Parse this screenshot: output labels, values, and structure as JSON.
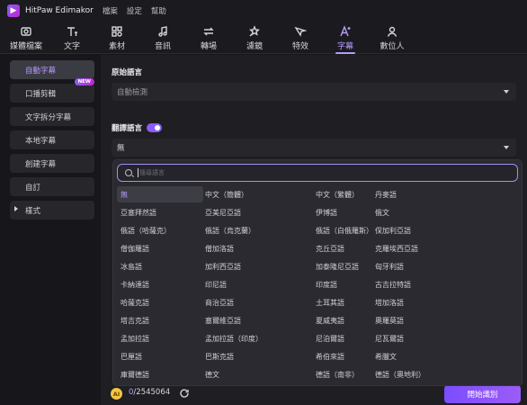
{
  "app": {
    "title": "HitPaw Edimakor",
    "logo": "logo-icon"
  },
  "menu": [
    "檔案",
    "設定",
    "幫助"
  ],
  "toolbar": [
    {
      "label": "媒體檔案",
      "icon": "media-icon",
      "active": false
    },
    {
      "label": "文字",
      "icon": "text-icon",
      "active": false
    },
    {
      "label": "素材",
      "icon": "material-icon",
      "active": false
    },
    {
      "label": "音訊",
      "icon": "music-icon",
      "active": false
    },
    {
      "label": "轉場",
      "icon": "transition-icon",
      "active": false
    },
    {
      "label": "濾鏡",
      "icon": "filter-icon",
      "active": false
    },
    {
      "label": "特效",
      "icon": "effect-icon",
      "active": false
    },
    {
      "label": "字幕",
      "icon": "subtitle-icon",
      "active": true
    },
    {
      "label": "數位人",
      "icon": "avatar-icon",
      "active": false
    }
  ],
  "sidebar": {
    "items": [
      {
        "label": "自動字幕",
        "active": true
      },
      {
        "label": "口播剪輯",
        "badge": "NEW"
      },
      {
        "label": "文字拆分字幕"
      },
      {
        "label": "本地字幕"
      },
      {
        "label": "創建字幕"
      },
      {
        "label": "自訂"
      },
      {
        "label": "樣式",
        "expandable": true
      }
    ]
  },
  "main": {
    "original_language_label": "原始語言",
    "original_language_value": "自動檢測",
    "translate_label": "翻譯語言",
    "translate_value": "無",
    "search_placeholder": "搜尋語言"
  },
  "languages": [
    "無",
    "中文（簡體）",
    "中文（繁體）",
    "丹麥語",
    "亞塞拜然語",
    "亞美尼亞語",
    "伊博語",
    "俄文",
    "俄語（哈薩克）",
    "俄語（烏克蘭）",
    "俄語（白俄羅斯）",
    "保加利亞語",
    "僧伽羅語",
    "僧加洛語",
    "克丘亞語",
    "克羅埃西亞語",
    "冰島語",
    "加利西亞語",
    "加泰隆尼亞語",
    "匈牙利語",
    "卡納達語",
    "印尼語",
    "印度語",
    "古吉拉特語",
    "哈薩克語",
    "商治亞語",
    "土耳其語",
    "塔加洛語",
    "塔吉克語",
    "塞爾維亞語",
    "夏威夷語",
    "奧羅莫語",
    "孟加拉語",
    "孟加拉語（印度）",
    "尼泊爾語",
    "尼瓦爾語",
    "巴厘語",
    "巴斯克語",
    "希伯來語",
    "希臘文",
    "庫爾德語",
    "德文",
    "德語（南非）",
    "德語（奧地利）"
  ],
  "selected_language": "無",
  "footer": {
    "credits_used": "0",
    "credits_total": "/2545064",
    "start_label": "開始識別"
  },
  "colors": {
    "accent": "#b79bff",
    "button": "#7c4dff",
    "background": "#1e1e23"
  }
}
